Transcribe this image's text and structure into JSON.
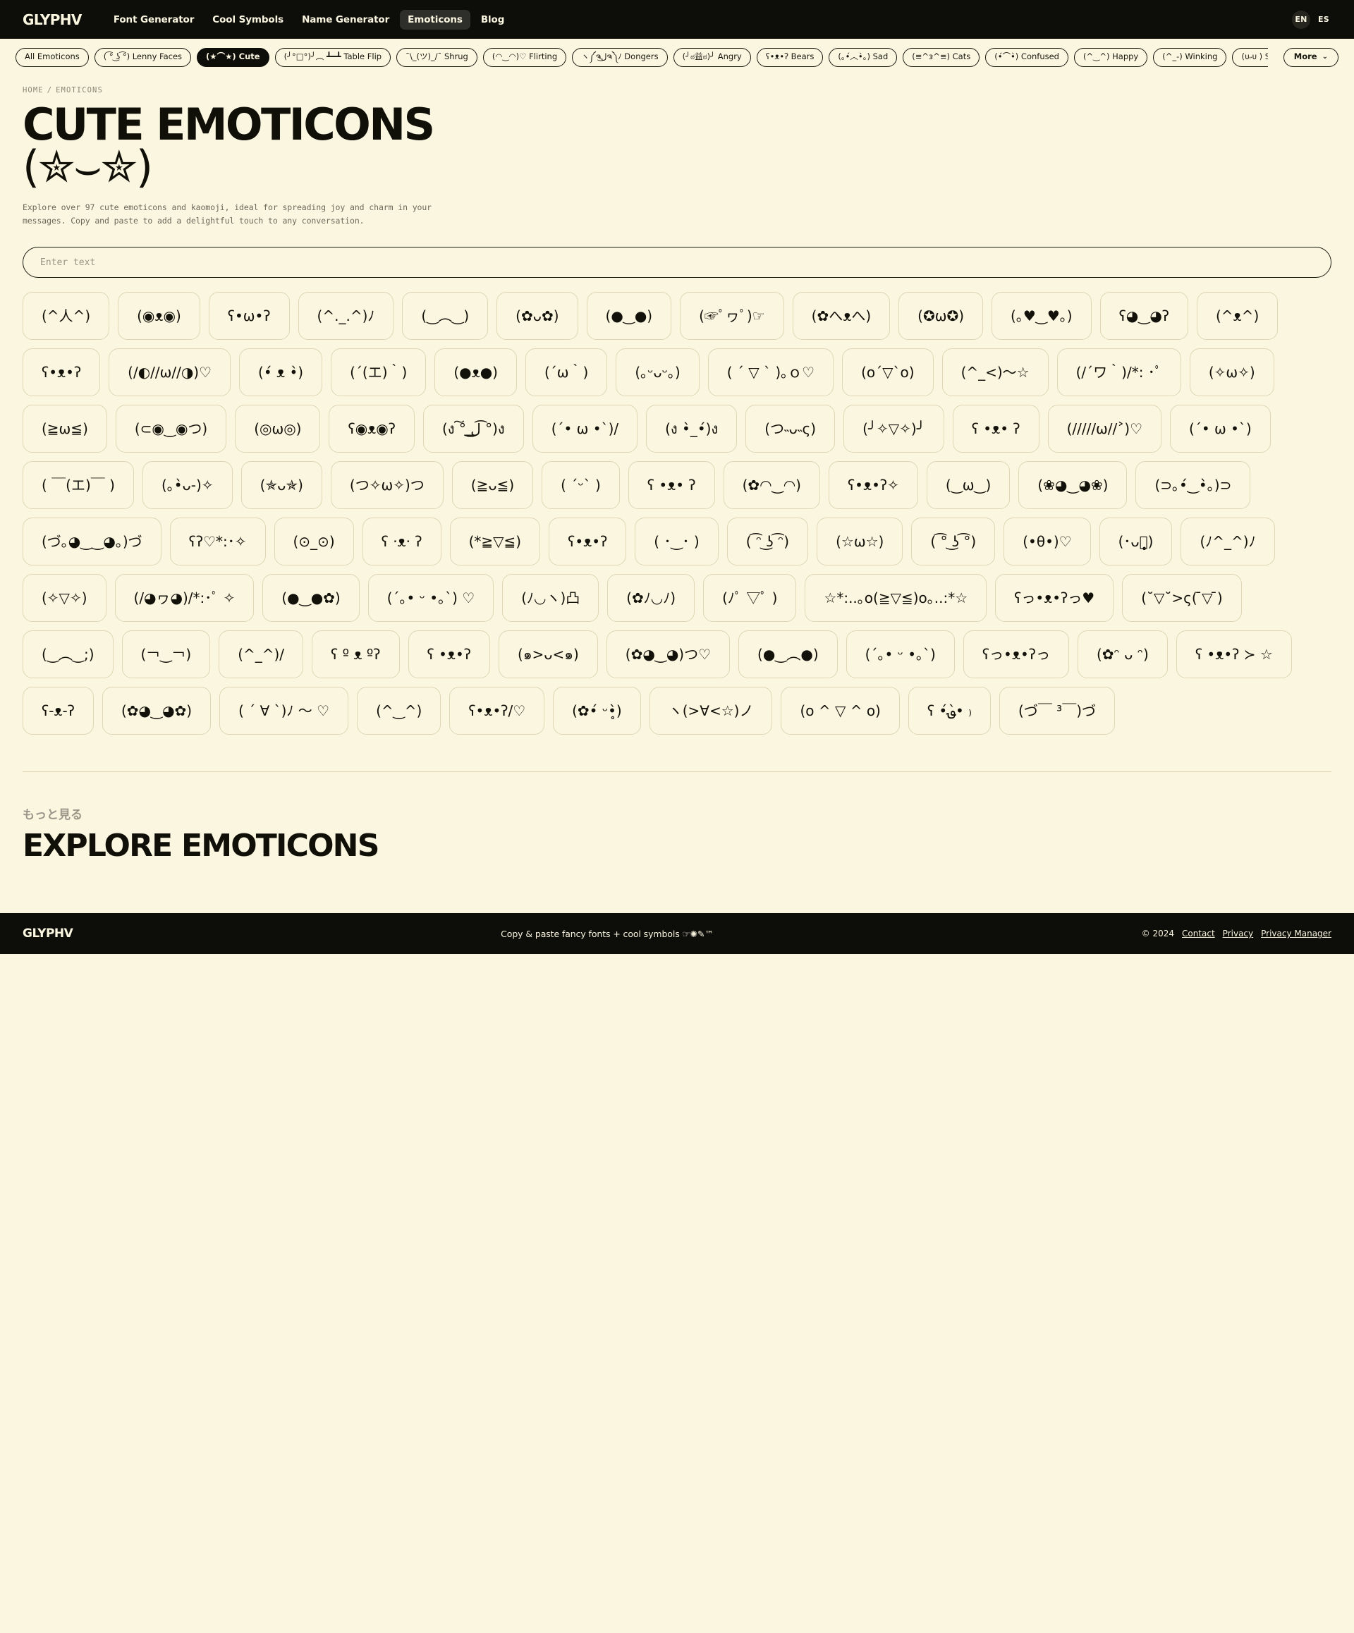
{
  "header": {
    "brand": "GLYPHV",
    "nav": [
      {
        "label": "Font Generator",
        "active": false
      },
      {
        "label": "Cool Symbols",
        "active": false
      },
      {
        "label": "Name Generator",
        "active": false
      },
      {
        "label": "Emoticons",
        "active": true
      },
      {
        "label": "Blog",
        "active": false
      }
    ],
    "languages": [
      {
        "label": "EN",
        "active": true
      },
      {
        "label": "ES",
        "active": false
      }
    ]
  },
  "chips": [
    {
      "label": "All Emoticons",
      "selected": false
    },
    {
      "label": "( ͡° ͜ʖ ͡°) Lenny Faces",
      "selected": false
    },
    {
      "label": "(★⌒★) Cute",
      "selected": true
    },
    {
      "label": "(╯°□°)╯︵ ┻━┻ Table Flip",
      "selected": false
    },
    {
      "label": "¯\\_(ツ)_/¯ Shrug",
      "selected": false
    },
    {
      "label": "(◠‿◠)♡ Flirting",
      "selected": false
    },
    {
      "label": "ヽ༼ຈل͜ຈ༽ﾉ Dongers",
      "selected": false
    },
    {
      "label": "(╯ಠ益ಠ)╯ Angry",
      "selected": false
    },
    {
      "label": "ʕ•ᴥ•ʔ Bears",
      "selected": false
    },
    {
      "label": "(｡•́︿•̀｡) Sad",
      "selected": false
    },
    {
      "label": "(≡^ᴈ^≡) Cats",
      "selected": false
    },
    {
      "label": "(•́⌒•̀) Confused",
      "selected": false
    },
    {
      "label": "(^‿^) Happy",
      "selected": false
    },
    {
      "label": "(^_-) Winking",
      "selected": false
    },
    {
      "label": "(ᴜ˶ᴜ ) Shy",
      "selected": false
    }
  ],
  "more_chip": {
    "label": "More",
    "caret": "⌄"
  },
  "breadcrumb": {
    "home": "HOME",
    "separator": "/",
    "current": "EMOTICONS"
  },
  "title": {
    "main": "CUTE EMOTICONS",
    "kaomoji": "(✮⌣✮)"
  },
  "description": "Explore over 97 cute emoticons and kaomoji, ideal for spreading joy and charm in your messages. Copy and paste to add a delightful touch to any conversation.",
  "search": {
    "placeholder": "Enter text",
    "value": ""
  },
  "emoticons": [
    "(^人^)",
    "(◉ᴥ◉)",
    "ʕ•ω•ʔ",
    "(^._.^)ﾉ",
    "(‿︵‿)",
    "(✿ᴗ✿)",
    "(●‿●)",
    "(☞ﾟヮﾟ)☞",
    "(✿へᴥへ)",
    "(✪ω✪)",
    "(｡♥‿♥｡)",
    "ʕ◕‿◕ʔ",
    "(^ᴥ^)",
    "ʕ•ᴥ•ʔ",
    "(/◐//ω//◑)♡",
    "(•́ ᴥ •̀)",
    "(´(エ)｀)",
    "(●ᴥ●)",
    "(´ω｀)",
    "(｡ᵕᴗᵕ｡)",
    "( ´ ▽ ` )｡ｏ♡",
    "(o´▽`o)",
    "(^_<)〜☆",
    "(/´ワ｀)/*: ･ﾟ",
    "(✧ω✧)",
    "(≧ω≦)",
    "(⊂◉‿◉つ)",
    "(◎ω◎)",
    "ʕ◉ᴥ◉ʔ",
    "(ง ͠° ͟ل͜ ͡°)ง",
    "(´• ω •`)/",
    "(ง •̀_•́)ง",
    "(つ˵ᴗ˵ς)",
    "(╯✧▽✧)╯",
    "ʕ •ᴥ• ʔ",
    "(/////ω//˃)♡",
    "(´• ω •`)",
    "( ￣(エ)￣ )",
    "(｡•̀ᴗ-)✧",
    "(✯ᴗ✯)",
    "(つ✧ω✧)つ",
    "(≧ᴗ≦)",
    "( ´ᵕ` )",
    "ʕ •ᴥ• ʔ",
    "(✿◠‿◠)",
    "ʕ•ᴥ•ʔ✧",
    "(‿ω‿)",
    "(❀◕‿◕❀)",
    "(⊃｡•́‿•̀｡)⊃",
    "(づ｡◕‿‿◕｡)づ",
    "ʕʔ♡*:･✧",
    "(⊙_⊙)",
    "ʕ ·ᴥ· ʔ",
    "(*≧▽≦)",
    "ʕ•ᴥ•ʔ",
    "( ･‿･ )",
    "( ͡ᵔ ͜ʖ ͡ᵔ)",
    "(☆ω☆)",
    "( ͡° ͜ʖ ͡°)",
    "(•θ•)♡",
    "(･ᴗ･̥̥̥)",
    "(ﾉ^_^)ﾉ",
    "(✧▽✧)",
    "(/◕ヮ◕)/*:･ﾟ ✧",
    "(●‿●✿)",
    "(´｡• ᵕ •｡`) ♡",
    "(ﾉ◡ヽ)凸",
    "(✿ﾉ◡ﾉ)",
    "(ﾉﾟ ▽ﾟ )",
    "☆*:..｡o(≧▽≦)o｡..:*☆",
    "ʕっ•ᴥ•ʔっ♥",
    "(˘▽˘>ς(  ̄▽ ̄)",
    "(‿︵‿;)",
    "(￢‿￢)",
    "(^_^)/",
    "ʕ º ᴥ ºʔ",
    "ʕ •ᴥ•ʔ",
    "(๑>ᴗ<๑)",
    "(✿◕‿◕)つ♡",
    "(●‿︵●)",
    "(´｡• ᵕ •｡`)",
    "ʕっ•ᴥ•ʔっ",
    "(✿ᵔ ᴗ ᵔ)",
    "ʕ •ᴥ•ʔ ≻ ☆",
    "ʕ-ᴥ-ʔ",
    "(✿◕‿◕✿)",
    "( ´ ∀ `)ﾉ 〜 ♡",
    "(^‿^)",
    "ʕ•ᴥ•ʔ/♡",
    "(✿•́ ᵕ•̥̀)",
    "ヽ(>∀<☆)ノ",
    "(o ^ ▽ ^ o)",
    "ʕ •́؈•̀ ₎",
    "(づ￣ ³￣)づ"
  ],
  "explore": {
    "kicker": "もっと見る",
    "heading": "EXPLORE EMOTICONS"
  },
  "footer": {
    "brand": "GLYPHV",
    "tagline": "Copy & paste fancy fonts + cool symbols ☞✺✎™",
    "copyright": "© 2024",
    "links": [
      "Contact",
      "Privacy",
      "Privacy Manager"
    ]
  }
}
